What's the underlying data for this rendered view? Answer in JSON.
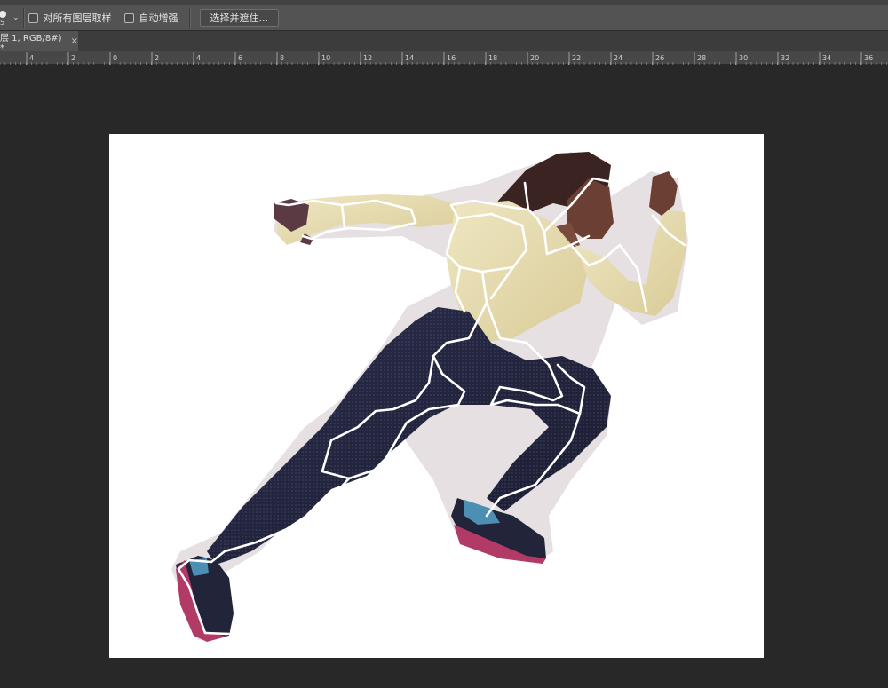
{
  "options_bar": {
    "tool_icon": "brush-size-icon",
    "tool_size_hint": "5",
    "checkbox_sample_all_layers": "对所有图层取样",
    "checkbox_auto_enhance": "自动增强",
    "select_and_mask_button": "选择并遮住..."
  },
  "document_tab": {
    "title": "层 1, RGB/8#) *",
    "close_symbol": "×"
  },
  "ruler": {
    "labels": [
      "4",
      "2",
      "0",
      "2",
      "4",
      "6",
      "8",
      "10",
      "12",
      "14",
      "16",
      "18",
      "20",
      "22",
      "24",
      "26",
      "28",
      "30",
      "32",
      "34",
      "36"
    ]
  },
  "colors": {
    "options_bar_bg": "#535353",
    "workspace_bg": "#282828",
    "canvas_bg": "#ffffff",
    "selection_outline": "#ffffff"
  }
}
